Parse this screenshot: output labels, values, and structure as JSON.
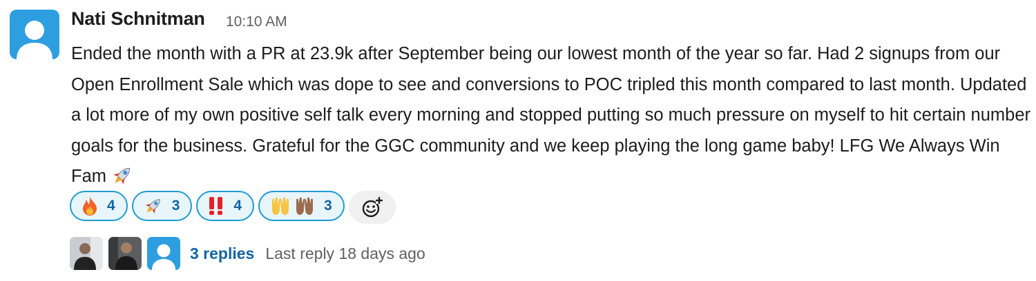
{
  "message": {
    "author": "Nati Schnitman",
    "time": "10:10 AM",
    "body": "Ended the month with a PR at 23.9k after September being our lowest month of the year so far. Had 2 signups from our Open Enrollment Sale which was dope to see and conversions to POC tripled this month compared to last month. Updated a lot more of my own positive self talk every morning and stopped putting so much pressure on myself to hit certain number goals for the business. Grateful for the GGC community and we keep playing the long game baby! LFG We Always Win Fam",
    "trailing_emoji": "rocket-icon"
  },
  "reactions": [
    {
      "emoji": "fire-icon",
      "count": "4"
    },
    {
      "emoji": "rocket-icon",
      "count": "3"
    },
    {
      "emoji": "double-exclamation-icon",
      "count": "4"
    },
    {
      "emoji": "raised-hands-icon",
      "count": "3"
    }
  ],
  "thread": {
    "replies_label": "3 replies",
    "last_reply": "Last reply 18 days ago"
  },
  "colors": {
    "link": "#1264a3",
    "reaction_border": "#1d9bd1",
    "reaction_bg": "#e8f5fa",
    "avatar_bg": "#2d9ee0",
    "meta_text": "#616061"
  }
}
